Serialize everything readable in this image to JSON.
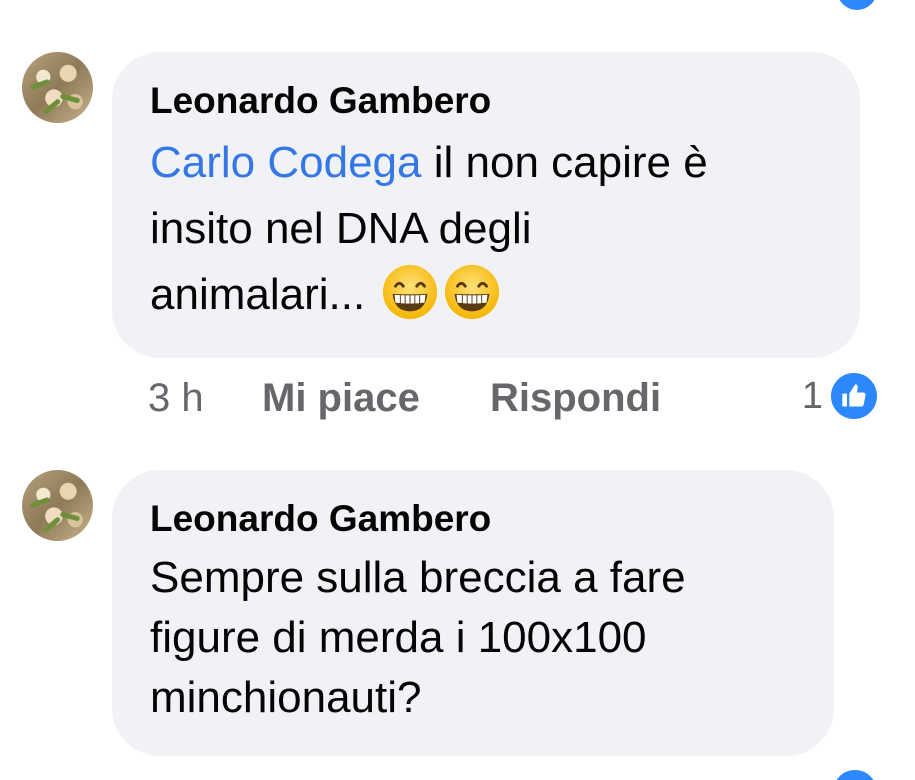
{
  "comments": [
    {
      "author": "Leonardo Gambero",
      "mention": "Carlo Codega",
      "text_line1": " il non capire è",
      "text_line2": "insito nel DNA degli",
      "text_line3": "animalari... ",
      "emoji": [
        "grinning-face-icon",
        "grinning-face-icon"
      ],
      "time": "3 h",
      "like_label": "Mi piace",
      "reply_label": "Rispondi",
      "reaction_count": "1",
      "reaction_icon": "thumbs-up-icon"
    },
    {
      "author": "Leonardo Gambero",
      "text_line1": "Sempre sulla breccia a fare",
      "text_line2": "figure di merda i 100x100",
      "text_line3": "minchionauti?"
    }
  ],
  "colors": {
    "bubble": "#f0f2f5",
    "mention": "#3578e5",
    "meta": "#65676b",
    "reaction_blue": "#2d88ff"
  }
}
